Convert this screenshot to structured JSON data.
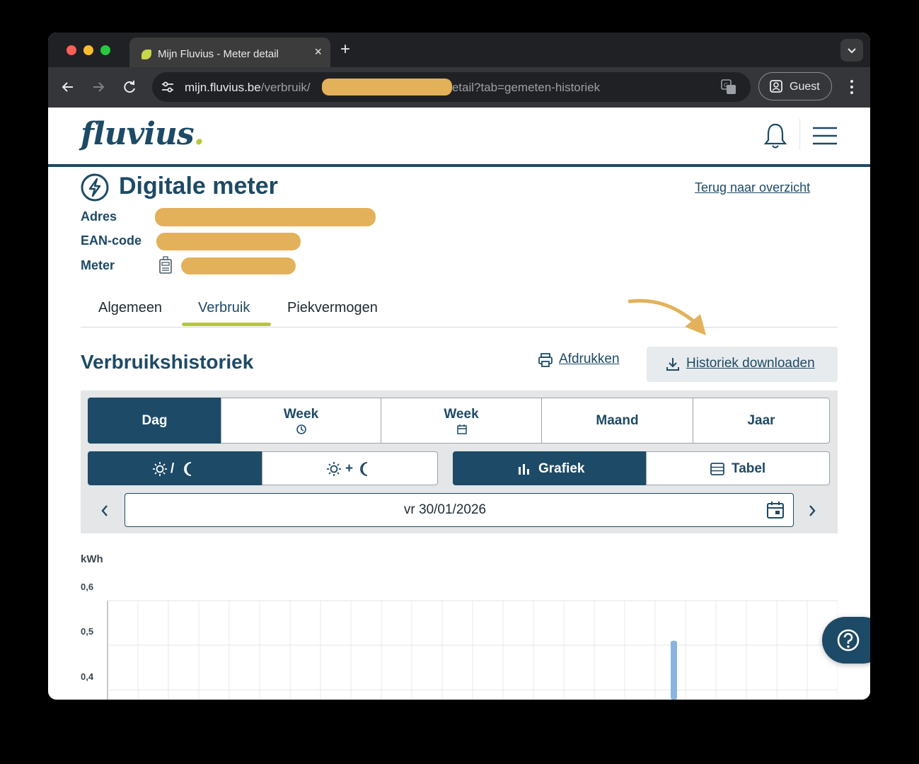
{
  "browser": {
    "tab_title": "Mijn Fluvius - Meter detail",
    "tab_close": "×",
    "new_tab": "+",
    "url_host": "mijn.fluvius.be",
    "url_path_start": "/verbruik/",
    "url_path_end": "/detail?tab=gemeten-historiek",
    "profile_label": "Guest"
  },
  "header": {
    "logo_text": "fluvius",
    "logo_dot": "."
  },
  "meter": {
    "title": "Digitale meter",
    "back_link": "Terug naar overzicht",
    "address_label": "Adres",
    "ean_label": "EAN-code",
    "meter_label": "Meter"
  },
  "tabs": [
    "Algemeen",
    "Verbruik",
    "Piekvermogen"
  ],
  "active_tab": "Verbruik",
  "history": {
    "title": "Verbruikshistoriek",
    "print_label": "Afdrukken",
    "download_label": "Historiek downloaden"
  },
  "period_buttons": [
    "Dag",
    "Week",
    "Week",
    "Maand",
    "Jaar"
  ],
  "active_period": "Dag",
  "tariff_options": [
    "/",
    "+"
  ],
  "view_options": [
    "Grafiek",
    "Tabel"
  ],
  "active_view": "Grafiek",
  "date_value": "vr 30/01/2026",
  "chart_data": {
    "type": "bar",
    "ylabel": "kWh",
    "yticks": [
      "0,6",
      "0,5",
      "0,4"
    ],
    "ylim_visible": [
      0.4,
      0.6
    ],
    "visible_bar_value": 0.51,
    "grid": true
  },
  "colors": {
    "brand_dark": "#1d4a66",
    "brand_lime": "#b5c934",
    "bar": "#8ab4e0",
    "annotation_arrow": "#e3b15a"
  }
}
